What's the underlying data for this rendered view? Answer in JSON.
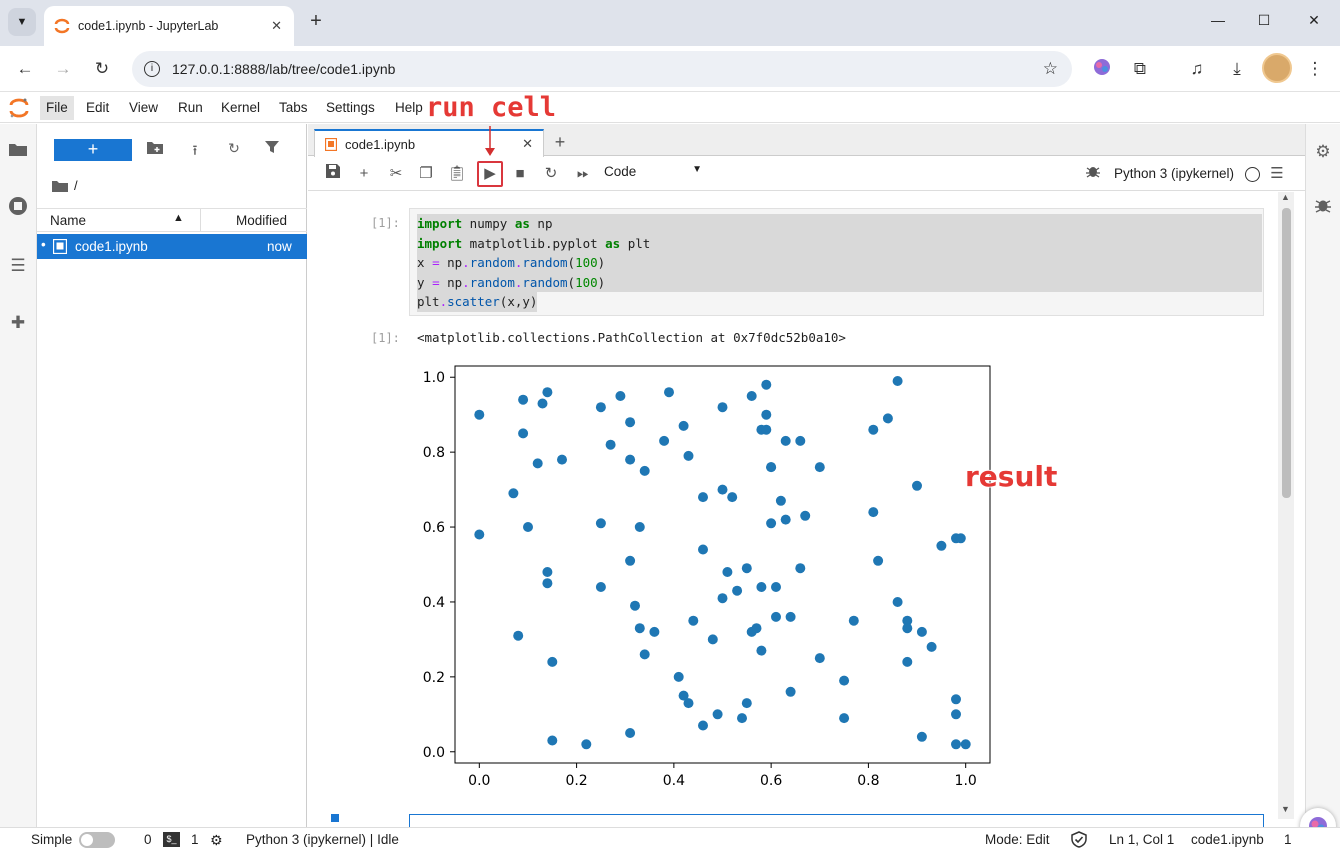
{
  "browser": {
    "tab_title": "code1.ipynb - JupyterLab",
    "url": "127.0.0.1:8888/lab/tree/code1.ipynb",
    "window_buttons": [
      "—",
      "☐",
      "✕"
    ]
  },
  "menubar": {
    "items": [
      "File",
      "Edit",
      "View",
      "Run",
      "Kernel",
      "Tabs",
      "Settings",
      "Help"
    ]
  },
  "filebrowser": {
    "new_label": "+",
    "path": "/",
    "columns": {
      "name": "Name",
      "modified": "Modified"
    },
    "files": [
      {
        "name": "code1.ipynb",
        "modified": "now"
      }
    ]
  },
  "notebook": {
    "tab_title": "code1.ipynb",
    "cell_type": "Code",
    "kernel_name": "Python 3 (ipykernel)",
    "input_prompt": "[1]:",
    "output_prompt": "[1]:",
    "output_text": "<matplotlib.collections.PathCollection at 0x7f0dc52b0a10>"
  },
  "statusbar": {
    "mode_label": "Simple",
    "terminals": "0",
    "kernels": "1",
    "kernel_status": "Python 3 (ipykernel) | Idle",
    "edit_mode": "Mode: Edit",
    "cursor": "Ln 1, Col 1",
    "file": "code1.ipynb",
    "notifications": "1"
  },
  "annotations": {
    "run": "run cell",
    "result": "result"
  },
  "colors": {
    "accent": "#1976d2",
    "points": "#1f77b4",
    "annotation": "#e53935"
  },
  "chart_data": {
    "type": "scatter",
    "xlim": [
      -0.05,
      1.05
    ],
    "ylim": [
      -0.03,
      1.03
    ],
    "xticks": [
      "0.0",
      "0.2",
      "0.4",
      "0.6",
      "0.8",
      "1.0"
    ],
    "yticks": [
      "0.0",
      "0.2",
      "0.4",
      "0.6",
      "0.8",
      "1.0"
    ],
    "points": [
      [
        0.0,
        0.9
      ],
      [
        0.0,
        0.58
      ],
      [
        0.07,
        0.69
      ],
      [
        0.08,
        0.31
      ],
      [
        0.09,
        0.94
      ],
      [
        0.09,
        0.85
      ],
      [
        0.1,
        0.6
      ],
      [
        0.12,
        0.77
      ],
      [
        0.13,
        0.93
      ],
      [
        0.14,
        0.96
      ],
      [
        0.14,
        0.48
      ],
      [
        0.14,
        0.45
      ],
      [
        0.15,
        0.24
      ],
      [
        0.15,
        0.03
      ],
      [
        0.17,
        0.78
      ],
      [
        0.22,
        0.02
      ],
      [
        0.25,
        0.92
      ],
      [
        0.25,
        0.61
      ],
      [
        0.25,
        0.44
      ],
      [
        0.27,
        0.82
      ],
      [
        0.29,
        0.95
      ],
      [
        0.31,
        0.88
      ],
      [
        0.31,
        0.78
      ],
      [
        0.31,
        0.51
      ],
      [
        0.31,
        0.05
      ],
      [
        0.32,
        0.39
      ],
      [
        0.33,
        0.33
      ],
      [
        0.33,
        0.6
      ],
      [
        0.34,
        0.75
      ],
      [
        0.34,
        0.26
      ],
      [
        0.36,
        0.32
      ],
      [
        0.38,
        0.83
      ],
      [
        0.39,
        0.96
      ],
      [
        0.41,
        0.2
      ],
      [
        0.42,
        0.87
      ],
      [
        0.42,
        0.15
      ],
      [
        0.43,
        0.79
      ],
      [
        0.43,
        0.13
      ],
      [
        0.44,
        0.35
      ],
      [
        0.46,
        0.68
      ],
      [
        0.46,
        0.54
      ],
      [
        0.46,
        0.07
      ],
      [
        0.48,
        0.3
      ],
      [
        0.49,
        0.1
      ],
      [
        0.5,
        0.7
      ],
      [
        0.5,
        0.92
      ],
      [
        0.5,
        0.41
      ],
      [
        0.51,
        0.48
      ],
      [
        0.52,
        0.68
      ],
      [
        0.53,
        0.43
      ],
      [
        0.54,
        0.09
      ],
      [
        0.55,
        0.49
      ],
      [
        0.55,
        0.13
      ],
      [
        0.56,
        0.95
      ],
      [
        0.56,
        0.32
      ],
      [
        0.57,
        0.33
      ],
      [
        0.58,
        0.86
      ],
      [
        0.58,
        0.44
      ],
      [
        0.58,
        0.27
      ],
      [
        0.59,
        0.98
      ],
      [
        0.59,
        0.9
      ],
      [
        0.59,
        0.86
      ],
      [
        0.6,
        0.76
      ],
      [
        0.6,
        0.61
      ],
      [
        0.61,
        0.44
      ],
      [
        0.61,
        0.36
      ],
      [
        0.62,
        0.67
      ],
      [
        0.63,
        0.83
      ],
      [
        0.63,
        0.62
      ],
      [
        0.64,
        0.36
      ],
      [
        0.64,
        0.16
      ],
      [
        0.66,
        0.83
      ],
      [
        0.66,
        0.49
      ],
      [
        0.67,
        0.63
      ],
      [
        0.7,
        0.76
      ],
      [
        0.7,
        0.25
      ],
      [
        0.75,
        0.19
      ],
      [
        0.75,
        0.09
      ],
      [
        0.77,
        0.35
      ],
      [
        0.81,
        0.86
      ],
      [
        0.81,
        0.64
      ],
      [
        0.82,
        0.51
      ],
      [
        0.84,
        0.89
      ],
      [
        0.86,
        0.99
      ],
      [
        0.86,
        0.4
      ],
      [
        0.88,
        0.35
      ],
      [
        0.88,
        0.33
      ],
      [
        0.88,
        0.24
      ],
      [
        0.9,
        0.71
      ],
      [
        0.91,
        0.32
      ],
      [
        0.91,
        0.04
      ],
      [
        0.93,
        0.28
      ],
      [
        0.95,
        0.55
      ],
      [
        0.98,
        0.57
      ],
      [
        0.98,
        0.14
      ],
      [
        0.98,
        0.1
      ],
      [
        0.98,
        0.02
      ],
      [
        0.99,
        0.57
      ],
      [
        1.0,
        0.02
      ],
      [
        0.6,
        0.76
      ]
    ]
  }
}
